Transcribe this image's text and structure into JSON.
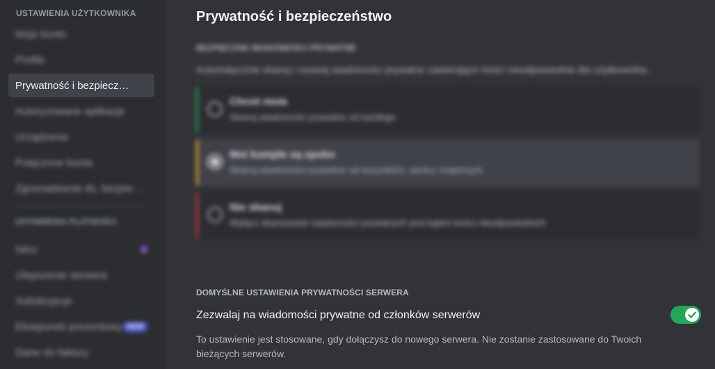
{
  "sidebar": {
    "header": "Ustawienia użytkownika",
    "items_top": [
      {
        "label": "Moje konto"
      },
      {
        "label": "Profile"
      },
      {
        "label": "Prywatność i bezpiecz…",
        "active": true
      },
      {
        "label": "Autoryzowane aplikacje"
      },
      {
        "label": "Urządzenia"
      },
      {
        "label": "Połączone konta"
      },
      {
        "label": "Zgromadzenie ds. bezpieczeństwa"
      }
    ],
    "header2": "Ustawienia płatności",
    "items_bottom": [
      {
        "label": "Nitro"
      },
      {
        "label": "Ulepszenie serwera"
      },
      {
        "label": "Subskrypcje"
      },
      {
        "label": "Ekwipunek prezentowy",
        "badge": "NEW"
      },
      {
        "label": "Dane do faktury"
      }
    ]
  },
  "main": {
    "title": "Prywatność i bezpieczeństwo",
    "dm_filter": {
      "title": "Bezpieczne wiadomości prywatne",
      "description": "Automatycznie skanuj i usuwaj wiadomości prywatne zawierające treści nieodpowiednie dla użytkownika.",
      "options": [
        {
          "title": "Chroń mnie",
          "desc": "Skanuj wiadomości prywatne od każdego",
          "color": "#23a55a"
        },
        {
          "title": "Moi kumple są spoko",
          "desc": "Skanuj wiadomości prywatne od wszystkich, oprócz znajomych",
          "color": "#f0b232",
          "selected": true
        },
        {
          "title": "Nie skanuj",
          "desc": "Wyłącz skanowanie wiadomości prywatnych pod kątem treści nieodpowiednich",
          "color": "#da373c"
        }
      ]
    },
    "server_privacy": {
      "title": "Domyślne ustawienia prywatności serwera",
      "toggle_label": "Zezwalaj na wiadomości prywatne od członków serwerów",
      "toggle_desc": "To ustawienie jest stosowane, gdy dołączysz do nowego serwera. Nie zostanie zastosowane do Twoich bieżących serwerów.",
      "toggle_on": true
    }
  },
  "colors": {
    "accent_green": "#23a55a",
    "background": "#313338",
    "sidebar": "#2b2d31"
  }
}
